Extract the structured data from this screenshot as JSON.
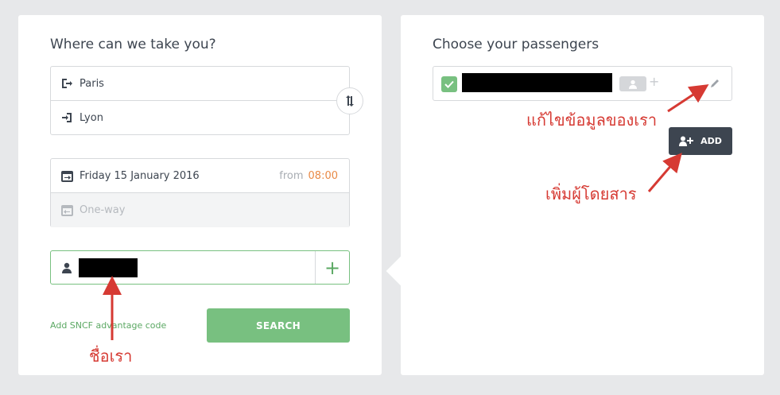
{
  "search_panel": {
    "title": "Where can we take you?",
    "origin": "Paris",
    "destination": "Lyon",
    "outbound_date": "Friday 15 January 2016",
    "from_label": "from",
    "from_time": "08:00",
    "return_placeholder": "One-way",
    "advantage_link": "Add SNCF advantage code",
    "search_button": "SEARCH"
  },
  "passengers_panel": {
    "title": "Choose your passengers",
    "add_button": "ADD"
  },
  "annotations": {
    "edit_info": "แก้ไขข้อมูลของเรา",
    "add_passenger": "เพิ่มผู้โดยสาร",
    "our_name": "ชื่อเรา"
  },
  "colors": {
    "accent_green": "#78c080",
    "time_orange": "#e98a46",
    "annotation_red": "#d63a33",
    "dark_button": "#3d4550"
  }
}
